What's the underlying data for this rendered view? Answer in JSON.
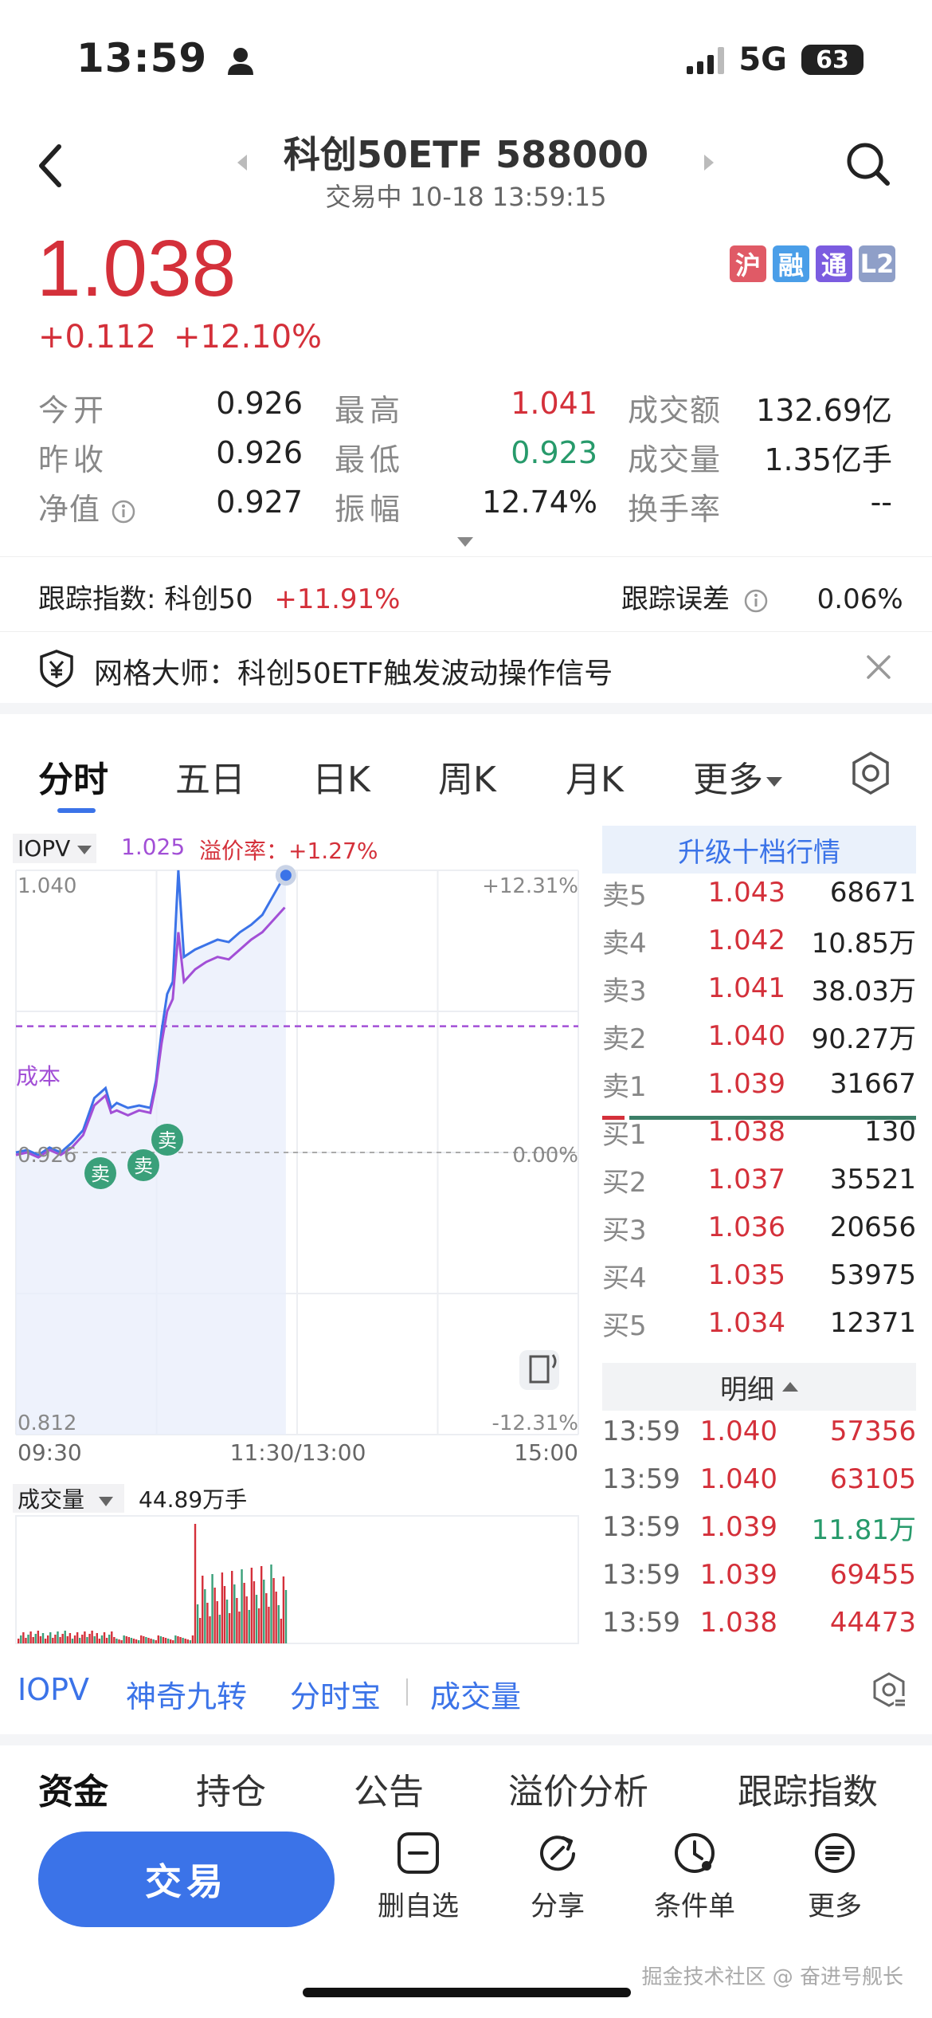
{
  "status_bar": {
    "time": "13:59",
    "network": "5G",
    "battery": "63"
  },
  "header": {
    "title": "科创50ETF 588000",
    "subtitle": "交易中 10-18 13:59:15"
  },
  "quote": {
    "price": "1.038",
    "change": "+0.112",
    "change_pct": "+12.10%"
  },
  "badges": [
    {
      "label": "沪",
      "color": "#e05a66"
    },
    {
      "label": "融",
      "color": "#4a9ee8"
    },
    {
      "label": "通",
      "color": "#7b5ce0"
    },
    {
      "label": "L2",
      "color": "#8f9fc8"
    }
  ],
  "stats": {
    "open_label": "今开",
    "open": "0.926",
    "high_label": "最高",
    "high": "1.041",
    "amount_label": "成交额",
    "amount": "132.69亿",
    "prev_close_label": "昨收",
    "prev_close": "0.926",
    "low_label": "最低",
    "low": "0.923",
    "volume_label": "成交量",
    "volume": "1.35亿手",
    "nav_label": "净值",
    "nav": "0.927",
    "amplitude_label": "振幅",
    "amplitude": "12.74%",
    "turnover_label": "换手率",
    "turnover": "--"
  },
  "tracking": {
    "index_label": "跟踪指数: 科创50",
    "index_change": "+11.91%",
    "error_label": "跟踪误差",
    "error": "0.06%"
  },
  "banner": {
    "text": "网格大师：科创50ETF触发波动操作信号"
  },
  "chart_tabs": [
    "分时",
    "五日",
    "日K",
    "周K",
    "月K",
    "更多"
  ],
  "iopv_bar": {
    "label": "IOPV",
    "value": "1.025",
    "premium_label": "溢价率：",
    "premium": "+1.27%"
  },
  "chart_data": {
    "type": "line",
    "y_top": "1.040",
    "y_bottom": "0.812",
    "y_mid": "0.926",
    "pct_top": "+12.31%",
    "pct_mid": "0.00%",
    "pct_bottom": "-12.31%",
    "x_labels": [
      "09:30",
      "11:30/13:00",
      "15:00"
    ],
    "cost_label": "成本",
    "sell_markers": [
      "卖",
      "卖",
      "卖"
    ],
    "ylim": [
      0.812,
      1.04
    ],
    "series": [
      {
        "color": "#3b73e8",
        "x": [
          0,
          10,
          20,
          30,
          40,
          50,
          60,
          70,
          80,
          85,
          90,
          100,
          110,
          120,
          125,
          130,
          135,
          140,
          145,
          150,
          160,
          170,
          180,
          190,
          200,
          210,
          220,
          230,
          240,
          241
        ],
        "values": [
          0.926,
          0.927,
          0.925,
          0.928,
          0.926,
          0.93,
          0.935,
          0.948,
          0.952,
          0.944,
          0.946,
          0.944,
          0.945,
          0.944,
          0.955,
          0.975,
          0.99,
          0.995,
          1.04,
          1.005,
          1.008,
          1.01,
          1.012,
          1.011,
          1.015,
          1.018,
          1.022,
          1.03,
          1.038,
          1.038
        ]
      },
      {
        "color": "#a24fd6",
        "x": [
          0,
          10,
          20,
          30,
          40,
          50,
          60,
          70,
          80,
          85,
          90,
          100,
          110,
          120,
          125,
          130,
          135,
          140,
          145,
          150,
          160,
          170,
          180,
          190,
          200,
          210,
          220,
          230,
          240
        ],
        "values": [
          0.925,
          0.926,
          0.924,
          0.927,
          0.925,
          0.928,
          0.933,
          0.945,
          0.949,
          0.942,
          0.943,
          0.941,
          0.943,
          0.942,
          0.953,
          0.97,
          0.983,
          0.988,
          1.015,
          0.995,
          1.0,
          1.003,
          1.005,
          1.004,
          1.008,
          1.012,
          1.015,
          1.02,
          1.025
        ]
      }
    ]
  },
  "volume_bar": {
    "label": "成交量",
    "value": "44.89万手"
  },
  "orderbook": {
    "header": "升级十档行情",
    "asks": [
      {
        "label": "卖5",
        "price": "1.043",
        "vol": "68671"
      },
      {
        "label": "卖4",
        "price": "1.042",
        "vol": "10.85万"
      },
      {
        "label": "卖3",
        "price": "1.041",
        "vol": "38.03万"
      },
      {
        "label": "卖2",
        "price": "1.040",
        "vol": "90.27万"
      },
      {
        "label": "卖1",
        "price": "1.039",
        "vol": "31667"
      }
    ],
    "bids": [
      {
        "label": "买1",
        "price": "1.038",
        "vol": "130"
      },
      {
        "label": "买2",
        "price": "1.037",
        "vol": "35521"
      },
      {
        "label": "买3",
        "price": "1.036",
        "vol": "20656"
      },
      {
        "label": "买4",
        "price": "1.035",
        "vol": "53975"
      },
      {
        "label": "买5",
        "price": "1.034",
        "vol": "12371"
      }
    ],
    "detail_header": "明细",
    "details": [
      {
        "time": "13:59",
        "price": "1.040",
        "vol": "57356",
        "vol_color": "red"
      },
      {
        "time": "13:59",
        "price": "1.040",
        "vol": "63105",
        "vol_color": "red"
      },
      {
        "time": "13:59",
        "price": "1.039",
        "vol": "11.81万",
        "vol_color": "green"
      },
      {
        "time": "13:59",
        "price": "1.039",
        "vol": "69455",
        "vol_color": "red"
      },
      {
        "time": "13:59",
        "price": "1.038",
        "vol": "44473",
        "vol_color": "red"
      }
    ]
  },
  "tools": [
    "IOPV",
    "神奇九转",
    "分时宝",
    "成交量"
  ],
  "bottom_tabs": [
    "资金",
    "持仓",
    "公告",
    "溢价分析",
    "跟踪指数"
  ],
  "actions": {
    "trade": "交易",
    "remove": "删自选",
    "share": "分享",
    "condition": "条件单",
    "more": "更多"
  },
  "watermark": "掘金技术社区 @ 奋进号舰长"
}
